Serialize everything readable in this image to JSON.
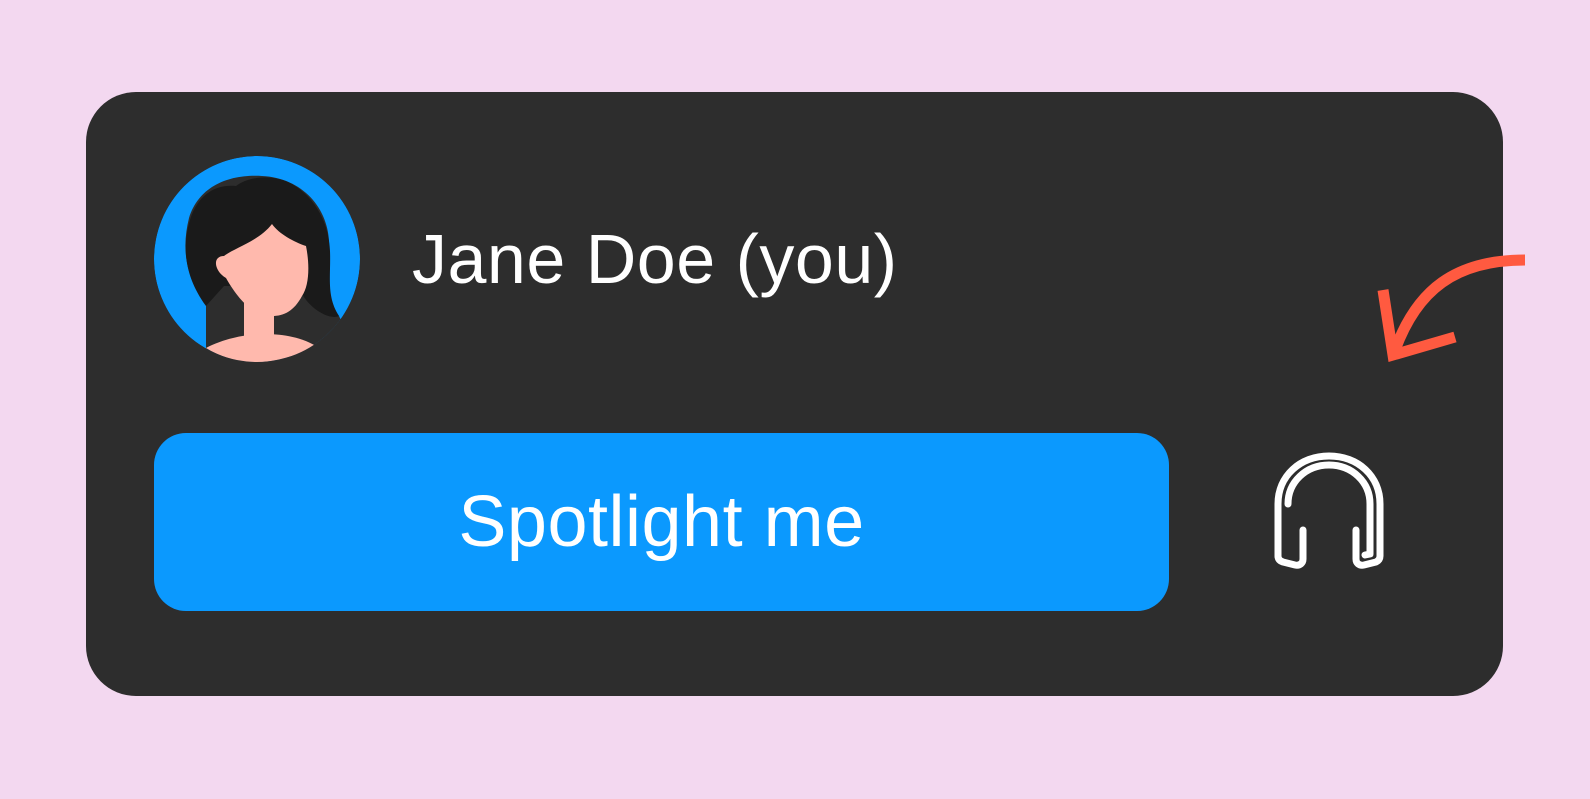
{
  "participant": {
    "name": "Jane Doe (you)",
    "avatar_icon": "user-avatar-icon"
  },
  "actions": {
    "spotlight_label": "Spotlight me",
    "audio_icon": "headphones-icon"
  },
  "annotation": {
    "arrow_icon": "curved-arrow-icon",
    "arrow_color": "#ff5a40"
  },
  "colors": {
    "background": "#f3d8f0",
    "card": "#2d2d2d",
    "accent": "#0b99fe",
    "skin": "#ffb9ad",
    "hair": "#1a1a1a"
  }
}
